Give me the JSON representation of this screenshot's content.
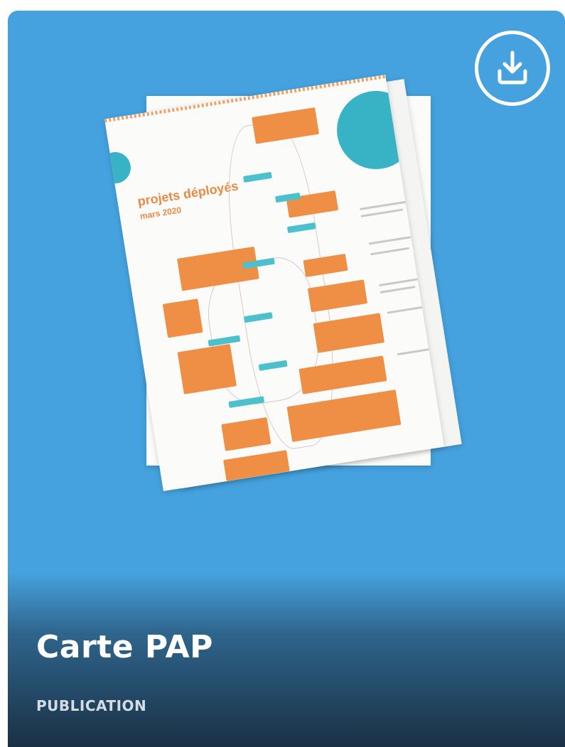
{
  "card": {
    "title": "Carte PAP",
    "type_label": "PUBLICATION",
    "background_color": "#45a2de",
    "download_icon": "download-icon"
  },
  "thumbnail": {
    "doc_title": "projets déployés",
    "doc_subtitle": "mars 2020"
  }
}
